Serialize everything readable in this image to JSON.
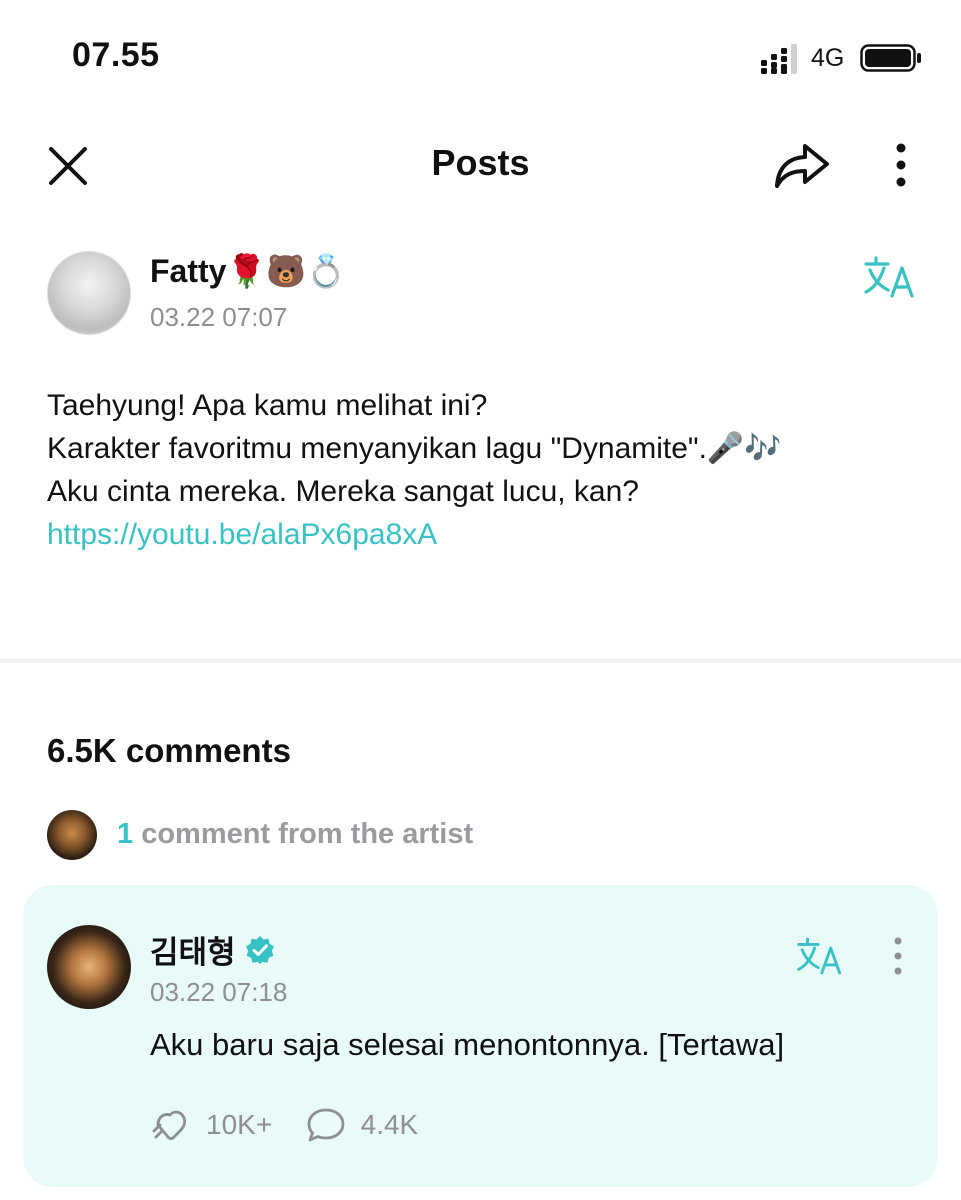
{
  "status_bar": {
    "time": "07.55",
    "network": "4G",
    "icons": [
      "signal-icon",
      "battery-icon"
    ]
  },
  "header": {
    "title": "Posts",
    "icons": [
      "close-icon",
      "share-icon",
      "more-vertical-icon"
    ]
  },
  "post": {
    "author_name": "Fatty🌹🐻💍",
    "timestamp": "03.22 07:07",
    "lines": [
      "Taehyung! Apa kamu melihat ini?",
      "Karakter favoritmu menyanyikan lagu \"Dynamite\".🎤🎶",
      "Aku cinta mereka. Mereka sangat lucu, kan?"
    ],
    "link": "https://youtu.be/alaPx6pa8xA",
    "translate_icon": "translate-icon"
  },
  "comments": {
    "count_label": "6.5K comments",
    "artist_count": "1",
    "artist_label": "comment from the artist"
  },
  "artist_comment": {
    "author_name": "김태형",
    "verified_icon": "verified-badge-icon",
    "timestamp": "03.22 07:18",
    "text": "Aku baru saja selesai menontonnya. [Tertawa]",
    "likes": "10K+",
    "replies": "4.4K"
  },
  "colors": {
    "accent": "#38c2c3",
    "card_background": "#e8fbf8",
    "secondary_text": "#8e8e93"
  }
}
